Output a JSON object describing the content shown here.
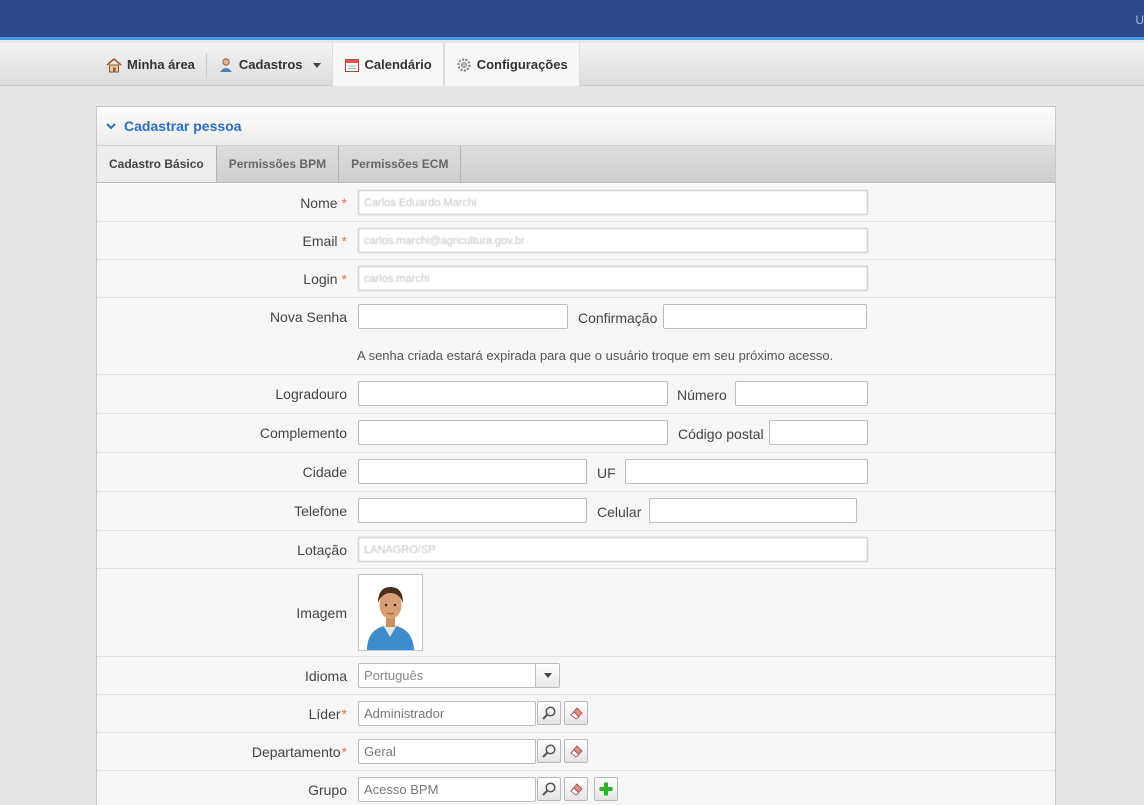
{
  "header": {
    "user_hint": "U"
  },
  "menu": {
    "minha_area": "Minha área",
    "cadastros": "Cadastros",
    "calendario": "Calendário",
    "configuracoes": "Configurações"
  },
  "panel": {
    "title": "Cadastrar pessoa"
  },
  "tabs": [
    "Cadastro Básico",
    "Permissões BPM",
    "Permissões ECM"
  ],
  "form": {
    "nome": {
      "label": "Nome",
      "value": "Carlos Eduardo Marchi"
    },
    "email": {
      "label": "Email",
      "value": "carlos.marchi@agricultura.gov.br"
    },
    "login": {
      "label": "Login",
      "value": "carlos.marchi"
    },
    "nova_senha": {
      "label": "Nova Senha",
      "value": ""
    },
    "confirmacao": {
      "label": "Confirmação",
      "value": ""
    },
    "senha_note": "A senha criada estará expirada para que o usuário troque em seu próximo acesso.",
    "logradouro": {
      "label": "Logradouro",
      "value": ""
    },
    "numero": {
      "label": "Número",
      "value": ""
    },
    "complemento": {
      "label": "Complemento",
      "value": ""
    },
    "codigo_postal": {
      "label": "Código postal",
      "value": ""
    },
    "cidade": {
      "label": "Cidade",
      "value": ""
    },
    "uf": {
      "label": "UF",
      "value": ""
    },
    "telefone": {
      "label": "Telefone",
      "value": ""
    },
    "celular": {
      "label": "Celular",
      "value": ""
    },
    "lotacao": {
      "label": "Lotação",
      "value": "LANAGRO/SP"
    },
    "imagem": {
      "label": "Imagem"
    },
    "idioma": {
      "label": "Idioma",
      "value": "Português"
    },
    "lider": {
      "label": "Líder",
      "value": "Administrador"
    },
    "departamento": {
      "label": "Departamento",
      "value": "Geral"
    },
    "grupo": {
      "label": "Grupo",
      "value": "Acesso BPM"
    },
    "required_mark": "*"
  },
  "colors": {
    "topbar": "#2f4a8c",
    "accent": "#38a0e8",
    "title": "#2a6ec1",
    "required": "#e07a3a",
    "add": "#2db42d"
  },
  "icons": [
    "home-icon",
    "user-icon",
    "calendar-icon",
    "gear-icon",
    "chevron-down-icon",
    "search-icon",
    "eraser-icon",
    "plus-icon",
    "avatar-image"
  ]
}
